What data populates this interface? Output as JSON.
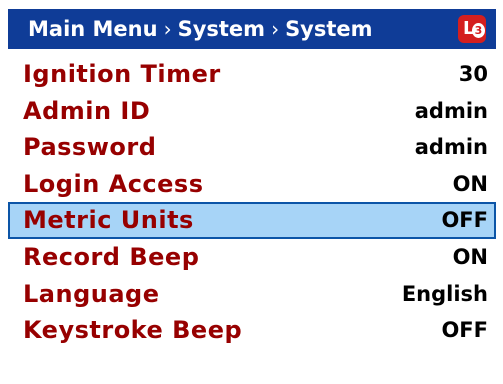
{
  "header": {
    "breadcrumb": [
      "Main Menu",
      "System",
      "System"
    ],
    "separator": "›",
    "logo": {
      "letter": "L",
      "number": "3"
    }
  },
  "menu": {
    "items": [
      {
        "label": "Ignition Timer",
        "value": "30"
      },
      {
        "label": "Admin ID",
        "value": "admin"
      },
      {
        "label": "Password",
        "value": "admin"
      },
      {
        "label": "Login Access",
        "value": "ON"
      },
      {
        "label": "Metric Units",
        "value": "OFF"
      },
      {
        "label": "Record Beep",
        "value": "ON"
      },
      {
        "label": "Language",
        "value": "English"
      },
      {
        "label": "Keystroke Beep",
        "value": "OFF"
      }
    ],
    "selected_index": 4
  },
  "colors": {
    "header_background": "#0f3c97",
    "label_color": "#970000",
    "value_color": "#000000",
    "selected_background": "#a7d4f7",
    "selected_border": "#0c55a7",
    "logo_red": "#d41f1f"
  }
}
